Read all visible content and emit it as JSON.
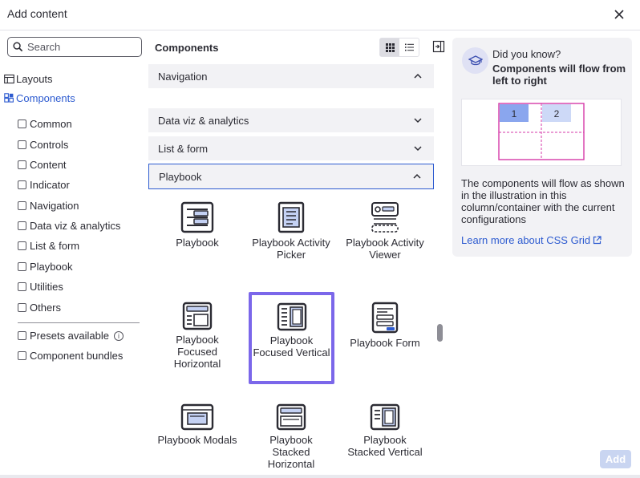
{
  "dialog": {
    "title": "Add content"
  },
  "search": {
    "placeholder": "Search"
  },
  "tree": [
    {
      "label": "Layouts"
    },
    {
      "label": "Components"
    }
  ],
  "filters": [
    {
      "label": "Common"
    },
    {
      "label": "Controls"
    },
    {
      "label": "Content"
    },
    {
      "label": "Indicator"
    },
    {
      "label": "Navigation"
    },
    {
      "label": "Data viz & analytics"
    },
    {
      "label": "List & form"
    },
    {
      "label": "Playbook"
    },
    {
      "label": "Utilities"
    },
    {
      "label": "Others"
    }
  ],
  "extra_filters": [
    {
      "label": "Presets available"
    },
    {
      "label": "Component bundles"
    }
  ],
  "components": {
    "title": "Components",
    "accordions": [
      {
        "label": "Navigation"
      },
      {
        "label": "Data viz & analytics"
      },
      {
        "label": "List & form"
      },
      {
        "label": "Playbook"
      }
    ],
    "tiles": [
      {
        "label": "Playbook",
        "icon": "playbook-icon"
      },
      {
        "label": "Playbook Activity Picker",
        "icon": "activity-picker-icon"
      },
      {
        "label": "Playbook Activity Viewer",
        "icon": "activity-viewer-icon"
      },
      {
        "label": "Playbook Focused Horizontal",
        "icon": "focused-horizontal-icon"
      },
      {
        "label": "Playbook Focused Vertical",
        "icon": "focused-vertical-icon"
      },
      {
        "label": "Playbook Form",
        "icon": "form-icon"
      },
      {
        "label": "Playbook Modals",
        "icon": "modals-icon"
      },
      {
        "label": "Playbook Stacked Horizontal",
        "icon": "stacked-horizontal-icon"
      },
      {
        "label": "Playbook Stacked Vertical",
        "icon": "stacked-vertical-icon"
      }
    ],
    "selected_index": 4
  },
  "info": {
    "kicker": "Did you know?",
    "headline": "Components will flow from left to right",
    "grid_cells": [
      "1",
      "2"
    ],
    "description": "The components will flow as shown in the illustration in this column/container with the current configurations",
    "link": "Learn more about CSS Grid"
  },
  "footer": {
    "add_label": "Add"
  },
  "colors": {
    "accent": "#2d5bd0",
    "selection": "#7b67ea",
    "grid_pink": "#d63aa8",
    "cell_blue": "#8aa6ee"
  }
}
